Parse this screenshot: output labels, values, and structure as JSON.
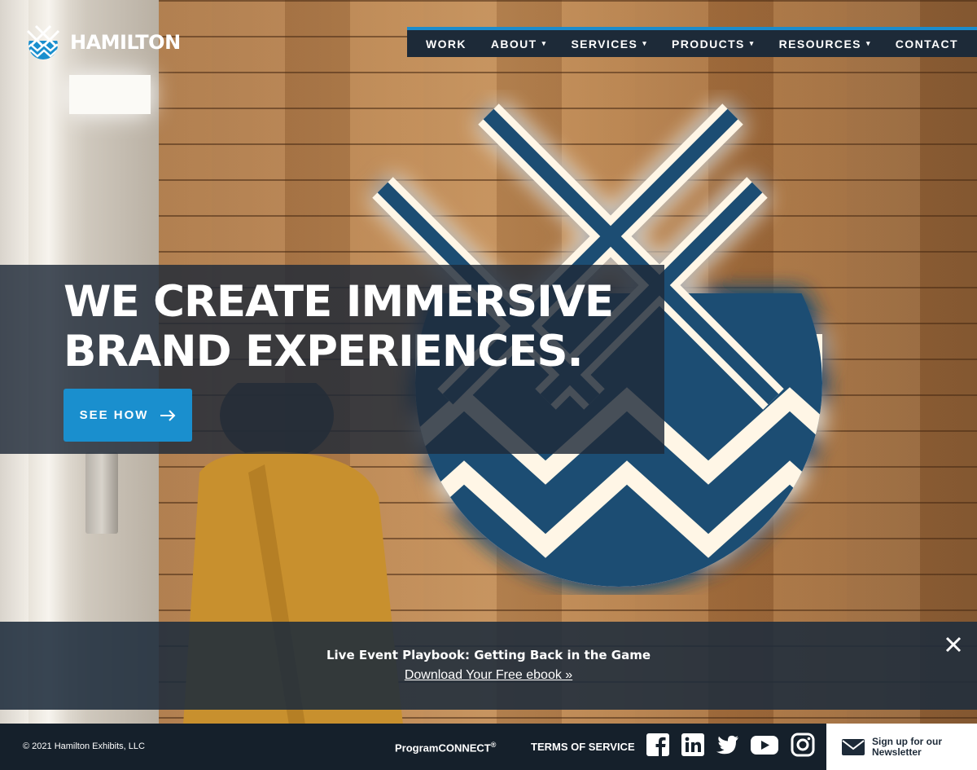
{
  "brand": {
    "name": "HAMILTON"
  },
  "nav": {
    "items": [
      {
        "label": "WORK",
        "caret": ""
      },
      {
        "label": "ABOUT",
        "caret": "▾"
      },
      {
        "label": "SERVICES",
        "caret": "▾"
      },
      {
        "label": "PRODUCTS",
        "caret": "▾"
      },
      {
        "label": "RESOURCES",
        "caret": "▾"
      },
      {
        "label": "CONTACT",
        "caret": ""
      }
    ]
  },
  "hero": {
    "headline_line1": "WE CREATE IMMERSIVE",
    "headline_line2": "BRAND EXPERIENCES.",
    "cta_label": "SEE HOW",
    "cta_icon": "arrow-right-icon"
  },
  "promo": {
    "title": "Live Event Playbook: Getting Back in the Game",
    "link_label": "Download Your Free ebook »",
    "close_icon": "close-icon"
  },
  "footer": {
    "copyright": "© 2021 Hamilton Exhibits, LLC",
    "program_connect": "ProgramCONNECT",
    "program_connect_mark": "®",
    "terms": "TERMS OF SERVICE",
    "social": [
      "facebook-icon",
      "linkedin-icon",
      "twitter-icon",
      "youtube-icon",
      "instagram-icon"
    ],
    "newsletter_line1": "Sign up for our",
    "newsletter_line2": "Newsletter"
  },
  "colors": {
    "accent": "#1a8fce",
    "nav_bg": "#1d2a38",
    "logo_blue": "#1f4e73",
    "footer_bg": "#15202b"
  }
}
